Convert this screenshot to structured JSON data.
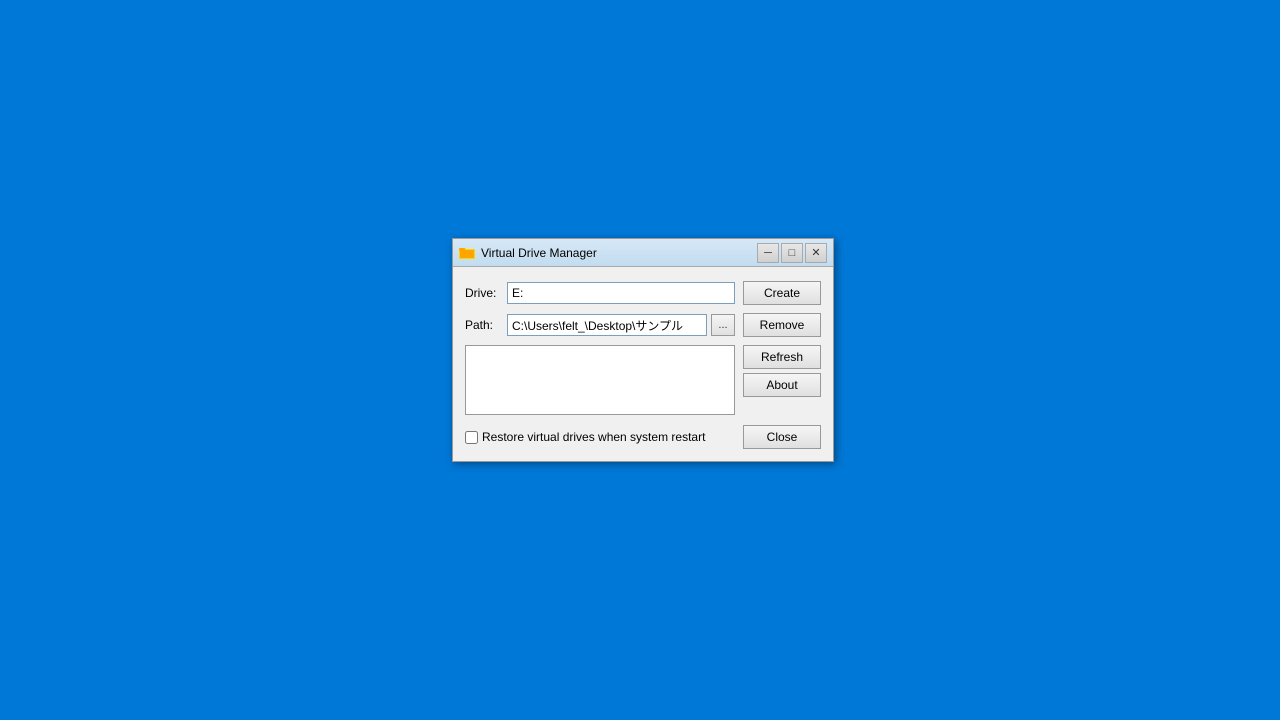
{
  "window": {
    "title": "Virtual Drive Manager",
    "titlebar": {
      "minimize_label": "─",
      "maximize_label": "□",
      "close_label": "✕"
    }
  },
  "form": {
    "drive_label": "Drive:",
    "drive_value": "E:",
    "path_label": "Path:",
    "path_value": "C:\\Users\\felt_\\Desktop\\サンプル",
    "browse_label": "..."
  },
  "buttons": {
    "create_label": "Create",
    "remove_label": "Remove",
    "refresh_label": "Refresh",
    "about_label": "About",
    "close_label": "Close"
  },
  "footer": {
    "checkbox_label": "Restore virtual drives when system restart",
    "checkbox_checked": false
  }
}
